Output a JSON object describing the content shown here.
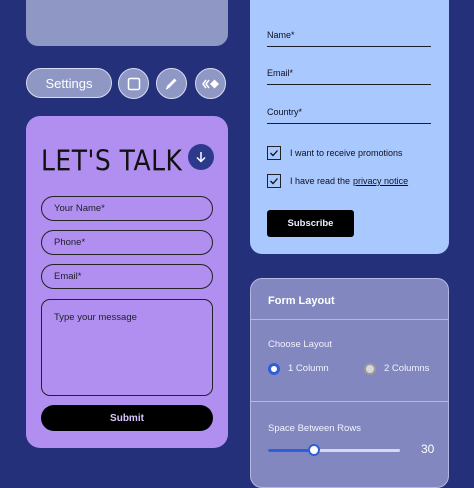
{
  "colors": {
    "background": "#25307a",
    "contact_card": "#b08ff0",
    "subscribe_card": "#a9c8fe",
    "layout_panel": "#8288bf",
    "accent_blue": "#2f5fd8"
  },
  "toolbar": {
    "settings_label": "Settings",
    "icons": [
      "square-icon",
      "pen-icon",
      "code-diamond-icon"
    ]
  },
  "contact_form": {
    "title": "LET'S TALK",
    "name_placeholder": "Your Name*",
    "phone_placeholder": "Phone*",
    "email_placeholder": "Email*",
    "message_placeholder": "Type your message",
    "submit_label": "Submit"
  },
  "subscribe_form": {
    "name_label": "Name*",
    "email_label": "Email*",
    "country_label": "Country*",
    "promo_label": "I want to receive promotions",
    "promo_checked": true,
    "notice_prefix": "I have read the",
    "notice_link": "privacy notice",
    "notice_checked": true,
    "subscribe_label": "Subscribe"
  },
  "layout_panel": {
    "title": "Form Layout",
    "choose_layout_label": "Choose Layout",
    "options": [
      {
        "label": "1 Column",
        "selected": true
      },
      {
        "label": "2 Columns",
        "selected": false
      }
    ],
    "spacing_label": "Space Between Rows",
    "spacing_value": "30",
    "spacing_fraction": 0.35
  }
}
